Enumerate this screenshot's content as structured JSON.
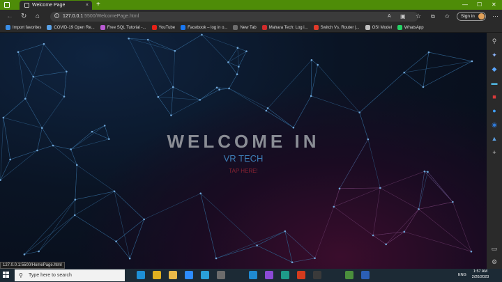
{
  "browser": {
    "tab_title": "Welcome Page",
    "tab_close": "×",
    "new_tab": "+",
    "url_host": "127.0.0.1",
    "url_rest": ":5500/WelcomePage.html",
    "signin_label": "Sign in",
    "status_url": "127.0.0.1:5500/HomePage.html",
    "win_minimize": "—",
    "win_maximize": "☐",
    "win_close": "✕"
  },
  "nav_icons": {
    "back": "←",
    "refresh": "↻",
    "home": "⌂"
  },
  "bookmarks": [
    {
      "label": "Import favorites",
      "color": "#3a8ee6"
    },
    {
      "label": "COVID-19 Open Re...",
      "color": "#5aa2e8"
    },
    {
      "label": "Free SQL Tutorial -...",
      "color": "#b95ad3"
    },
    {
      "label": "YouTube",
      "color": "#e62117"
    },
    {
      "label": "Facebook – log in o...",
      "color": "#1877f2"
    },
    {
      "label": "New Tab",
      "color": "#6d6d6d"
    },
    {
      "label": "Mahara Tech: Log i...",
      "color": "#d02b2b"
    },
    {
      "label": "Switch Vs. Router |...",
      "color": "#e23a2a"
    },
    {
      "label": "OSI Model",
      "color": "#c0c0c0"
    },
    {
      "label": "WhatsApp",
      "color": "#25d366"
    }
  ],
  "hero": {
    "title": "WELCOME IN",
    "subtitle": "VR TECH",
    "link": "TAP HERE!"
  },
  "taskbar": {
    "search_placeholder": "Type here to search",
    "time": "1:57 AM",
    "date": "2/20/2023",
    "lang": "ENG"
  },
  "colors": {
    "tab_strip": "#4e8c08",
    "title_text": "#8a8d95",
    "subtitle_text": "#3e7fb8",
    "link_text": "#8c2332"
  }
}
